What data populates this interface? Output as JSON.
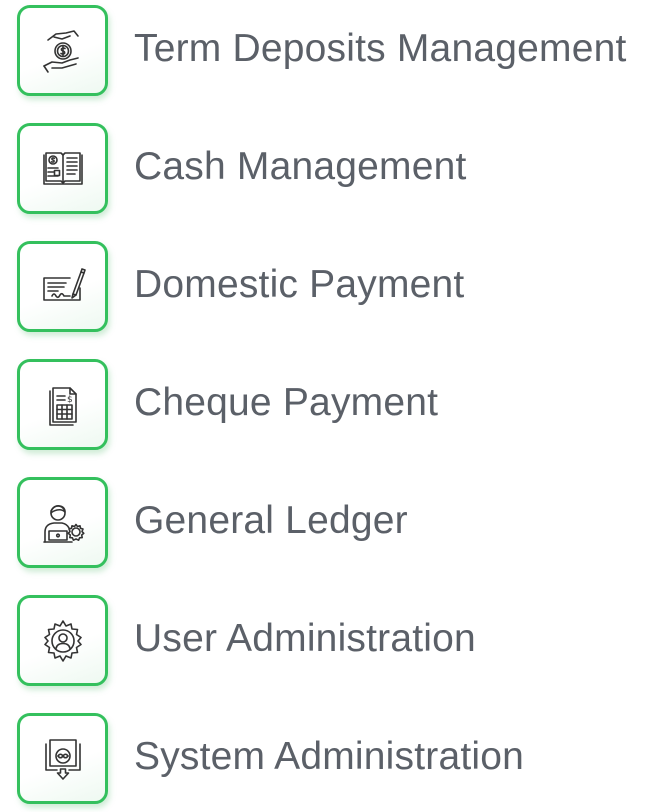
{
  "colors": {
    "accent": "#34c05d",
    "text": "#5b6068",
    "icon_stroke": "#333333"
  },
  "menu": {
    "items": [
      {
        "label": "Term Deposits Management",
        "icon": "money-hand-icon"
      },
      {
        "label": "Cash Management",
        "icon": "cash-ledger-book-icon"
      },
      {
        "label": "Domestic Payment",
        "icon": "cheque-pen-icon"
      },
      {
        "label": "Cheque Payment",
        "icon": "invoice-document-icon"
      },
      {
        "label": "General Ledger",
        "icon": "user-laptop-gear-icon"
      },
      {
        "label": "User Administration",
        "icon": "user-gear-icon"
      },
      {
        "label": "System Administration",
        "icon": "system-download-icon"
      }
    ]
  }
}
